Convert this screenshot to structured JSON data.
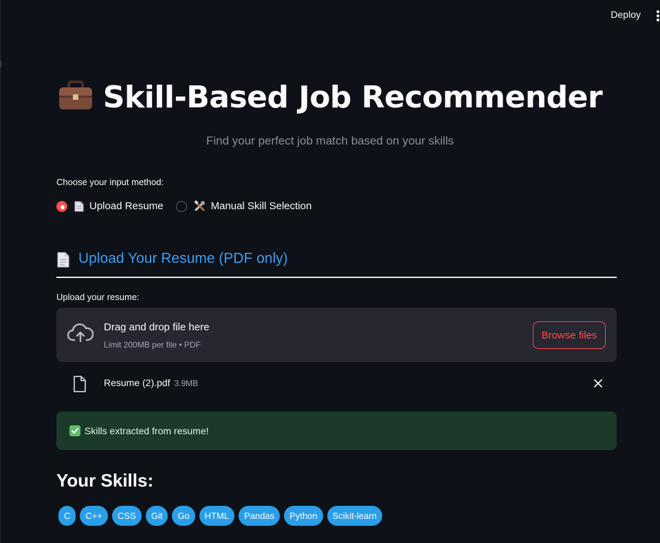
{
  "topbar": {
    "deploy_label": "Deploy"
  },
  "header": {
    "title": "Skill-Based Job Recommender",
    "subtitle": "Find your perfect job match based on your skills",
    "icon": "briefcase-icon"
  },
  "input_method": {
    "label": "Choose your input method:",
    "options": [
      {
        "label": "Upload Resume",
        "icon": "document-icon",
        "selected": true
      },
      {
        "label": "Manual Skill Selection",
        "icon": "tools-icon",
        "selected": false
      }
    ]
  },
  "upload_section": {
    "header": "Upload Your Resume (PDF only)",
    "field_label": "Upload your resume:",
    "dropzone": {
      "text": "Drag and drop file here",
      "limit": "Limit 200MB per file • PDF",
      "browse_label": "Browse files"
    },
    "file": {
      "name": "Resume (2).pdf",
      "size": "3.9MB"
    }
  },
  "status": {
    "success_message": "Skills extracted from resume!"
  },
  "skills": {
    "title": "Your Skills:",
    "items": [
      "C",
      "C++",
      "CSS",
      "Git",
      "Go",
      "HTML",
      "Pandas",
      "Python",
      "Scikit-learn"
    ]
  },
  "colors": {
    "background": "#0e1117",
    "accent_red": "#ff4b4b",
    "header_blue": "#3d9df3",
    "chip_blue": "#2a9ee8",
    "success_bg": "#1b3a29"
  }
}
